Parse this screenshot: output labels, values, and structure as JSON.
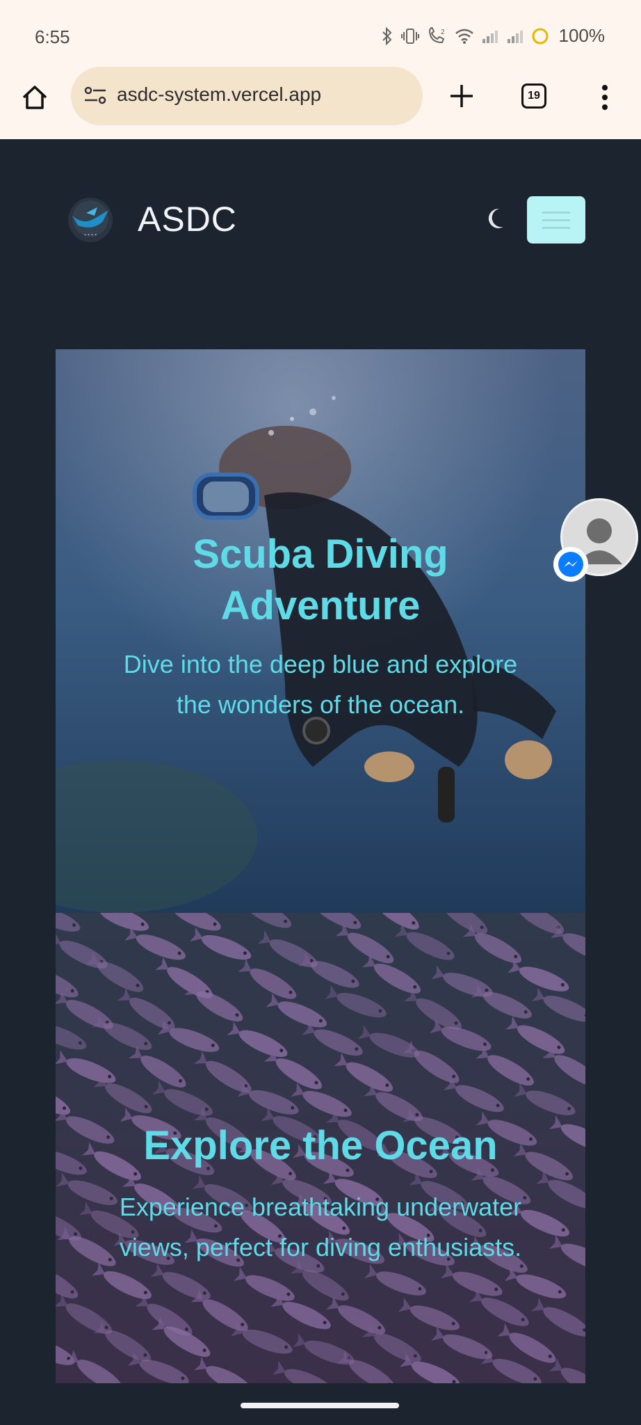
{
  "status_bar": {
    "time": "6:55",
    "battery": "100%",
    "icons": [
      "bluetooth-icon",
      "vibrate-icon",
      "wifi-calling-icon",
      "wifi-icon",
      "signal-icon",
      "signal-icon",
      "battery-icon"
    ]
  },
  "browser": {
    "url": "asdc-system.vercel.app",
    "tab_count": "19",
    "icons": [
      "home-icon",
      "site-info-icon",
      "plus-icon",
      "more-vert-icon"
    ]
  },
  "site": {
    "brand": "ASDC",
    "icons": [
      "moon-icon",
      "hamburger-icon"
    ]
  },
  "slides": [
    {
      "title_line1": "Scuba Diving",
      "title_line2": "Adventure",
      "sub_line1": "Dive into the deep blue and explore",
      "sub_line2": "the wonders of the ocean."
    },
    {
      "title": "Explore the Ocean",
      "sub_line1": "Experience breathtaking underwater",
      "sub_line2": "views, perfect for diving enthusiasts."
    }
  ],
  "colors": {
    "page_bg": "#1c2430",
    "accent": "#5fdbe8",
    "browser_bg": "#fdf5ee",
    "url_pill": "#f5e4cc",
    "menu_btn": "#b8f3f6",
    "messenger": "#0a7cff"
  }
}
